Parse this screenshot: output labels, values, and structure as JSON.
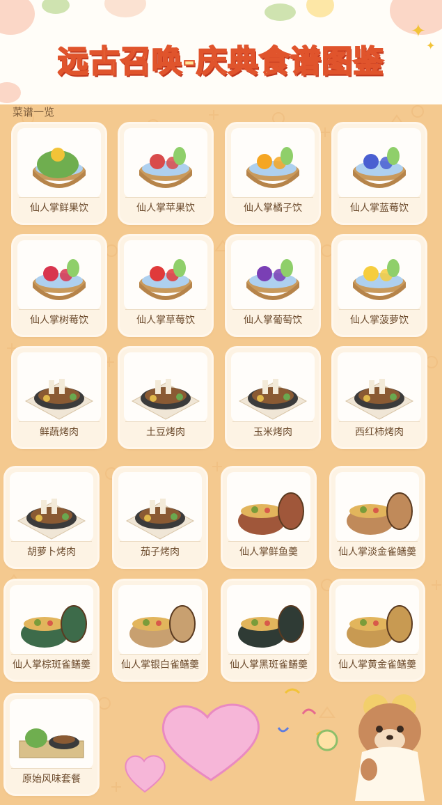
{
  "header": {
    "title": "远古召唤-庆典食谱图鉴"
  },
  "section_label": "菜谱一览",
  "recipes": [
    {
      "name": "仙人掌鲜果饮",
      "icon": "cactus-fruit-drink-icon"
    },
    {
      "name": "仙人掌苹果饮",
      "icon": "cactus-apple-drink-icon"
    },
    {
      "name": "仙人掌橘子饮",
      "icon": "cactus-orange-drink-icon"
    },
    {
      "name": "仙人掌蓝莓饮",
      "icon": "cactus-blueberry-drink-icon"
    },
    {
      "name": "仙人掌树莓饮",
      "icon": "cactus-raspberry-drink-icon"
    },
    {
      "name": "仙人掌草莓饮",
      "icon": "cactus-strawberry-drink-icon"
    },
    {
      "name": "仙人掌葡萄饮",
      "icon": "cactus-grape-drink-icon"
    },
    {
      "name": "仙人掌菠萝饮",
      "icon": "cactus-pineapple-drink-icon"
    },
    {
      "name": "鲜蔬烤肉",
      "icon": "vegetable-roast-meat-icon"
    },
    {
      "name": "土豆烤肉",
      "icon": "potato-roast-meat-icon"
    },
    {
      "name": "玉米烤肉",
      "icon": "corn-roast-meat-icon"
    },
    {
      "name": "西红柿烤肉",
      "icon": "tomato-roast-meat-icon"
    },
    {
      "name": "胡萝卜烤肉",
      "icon": "carrot-roast-meat-icon"
    },
    {
      "name": "茄子烤肉",
      "icon": "eggplant-roast-meat-icon"
    },
    {
      "name": "仙人掌鲜鱼羹",
      "icon": "cactus-fish-stew-icon"
    },
    {
      "name": "仙人掌淡金雀鳝羹",
      "icon": "cactus-pale-gold-eel-stew-icon"
    },
    {
      "name": "仙人掌棕斑雀鳝羹",
      "icon": "cactus-brown-spot-eel-stew-icon"
    },
    {
      "name": "仙人掌银白雀鳝羹",
      "icon": "cactus-silver-eel-stew-icon"
    },
    {
      "name": "仙人掌黑斑雀鳝羹",
      "icon": "cactus-black-spot-eel-stew-icon"
    },
    {
      "name": "仙人掌黄金雀鳝羹",
      "icon": "cactus-golden-eel-stew-icon"
    },
    {
      "name": "原始风味套餐",
      "icon": "primitive-flavor-set-meal-icon"
    }
  ],
  "colors": {
    "background": "#f4c98f",
    "title_fill": "#ffe79a",
    "title_stroke": "#e0542c",
    "card_bg": "#fdf3e4",
    "label_text": "#6b4a2c"
  }
}
